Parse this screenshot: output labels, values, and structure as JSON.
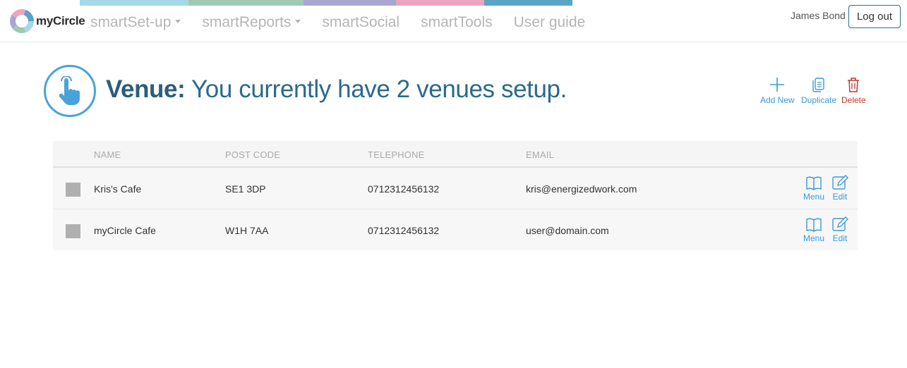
{
  "brand": {
    "name": "myCircle",
    "stripe_colors": [
      "#a6d8e8",
      "#9fc9b3",
      "#a9a6d2",
      "#e9a6be",
      "#5ba4c6"
    ]
  },
  "nav": {
    "items": [
      {
        "label": "smartSet-up",
        "dropdown": true
      },
      {
        "label": "smartReports",
        "dropdown": true
      },
      {
        "label": "smartSocial",
        "dropdown": false
      },
      {
        "label": "smartTools",
        "dropdown": false
      },
      {
        "label": "User guide",
        "dropdown": false
      }
    ]
  },
  "user": {
    "name": "James Bond",
    "logout_label": "Log out"
  },
  "page": {
    "title_strong": "Venue:",
    "title_rest": " You currently have 2 venues setup."
  },
  "actions": {
    "add_label": "Add New",
    "duplicate_label": "Duplicate",
    "delete_label": "Delete"
  },
  "table": {
    "headers": {
      "name": "NAME",
      "postcode": "POST CODE",
      "telephone": "TELEPHONE",
      "email": "EMAIL"
    },
    "rows": [
      {
        "name": "Kris's Cafe",
        "postcode": "SE1 3DP",
        "telephone": "0712312456132",
        "email": "kris@energizedwork.com",
        "menu_label": "Menu",
        "edit_label": "Edit"
      },
      {
        "name": "myCircle Cafe",
        "postcode": "W1H 7AA",
        "telephone": "0712312456132",
        "email": "user@domain.com",
        "menu_label": "Menu",
        "edit_label": "Edit"
      }
    ]
  },
  "colors": {
    "accent": "#3a9ad9",
    "title": "#2a5e7c",
    "delete": "#c0392b"
  }
}
